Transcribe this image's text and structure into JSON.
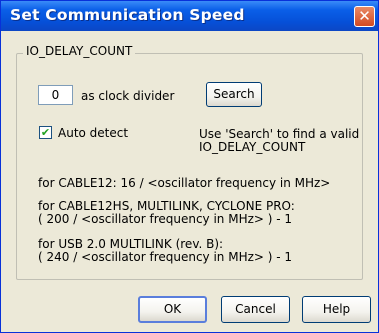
{
  "window": {
    "title": "Set Communication Speed"
  },
  "group": {
    "label": "IO_DELAY_COUNT"
  },
  "divider": {
    "value": "0",
    "suffix": "as clock divider"
  },
  "buttons": {
    "search": "Search",
    "ok": "OK",
    "cancel": "Cancel",
    "help": "Help"
  },
  "auto_detect": {
    "label": "Auto detect",
    "checked": true
  },
  "hint": {
    "line1": "Use 'Search' to find a valid",
    "line2": "IO_DELAY_COUNT"
  },
  "formulas": {
    "cable12": "for CABLE12: 16 / <oscillator frequency in MHz>",
    "cable12hs_1": "for CABLE12HS, MULTILINK, CYCLONE PRO:",
    "cable12hs_2": "( 200 / <oscillator frequency in MHz> ) - 1",
    "usb_1": "for USB 2.0 MULTILINK (rev. B):",
    "usb_2": "( 240 / <oscillator frequency in MHz> ) - 1"
  }
}
